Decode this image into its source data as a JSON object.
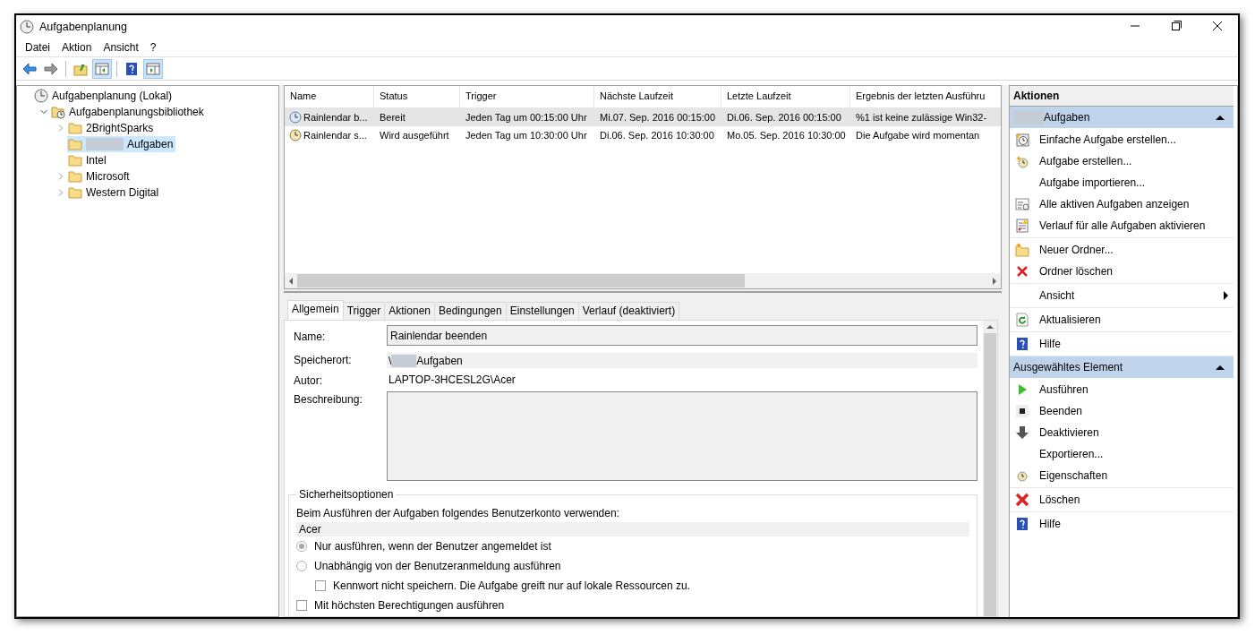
{
  "window": {
    "title": "Aufgabenplanung"
  },
  "menu": [
    "Datei",
    "Aktion",
    "Ansicht",
    "?"
  ],
  "toolbar": [
    [
      {
        "kind": "back",
        "on": false
      },
      {
        "kind": "forward",
        "on": false
      }
    ],
    [
      {
        "kind": "up",
        "on": false
      },
      {
        "kind": "tree-pane",
        "on": true
      }
    ],
    [
      {
        "kind": "help",
        "on": false
      },
      {
        "kind": "action-pane",
        "on": true
      }
    ]
  ],
  "tree": [
    {
      "label": "Aufgabenplanung (Lokal)",
      "kind": "scheduler",
      "selected": false,
      "redacted": false,
      "children": [
        {
          "label": "Aufgabenplanungsbibliothek",
          "kind": "library",
          "expanded": true,
          "selected": false,
          "redacted": false,
          "children": [
            {
              "label": "2BrightSparks",
              "kind": "folder",
              "expanded": false,
              "selected": false,
              "redacted": false
            },
            {
              "label": "Aufgaben",
              "kind": "folder",
              "selected": true,
              "redacted": true
            },
            {
              "label": "Intel",
              "kind": "folder",
              "selected": false,
              "redacted": false
            },
            {
              "label": "Microsoft",
              "kind": "folder",
              "expanded": false,
              "selected": false,
              "redacted": false
            },
            {
              "label": "Western Digital",
              "kind": "folder",
              "expanded": false,
              "selected": false,
              "redacted": false
            }
          ]
        }
      ]
    }
  ],
  "tasks": {
    "columns": [
      "Name",
      "Status",
      "Trigger",
      "Nächste Laufzeit",
      "Letzte Laufzeit",
      "Ergebnis der letzten Ausführu"
    ],
    "rows": [
      {
        "kind": "ready",
        "selected": true,
        "cells": [
          "Rainlendar b...",
          "Bereit",
          "Jeden Tag um 00:15:00 Uhr",
          "Mi.07. Sep. 2016 00:15:00",
          "Di.06. Sep. 2016 00:15:00",
          "%1 ist keine zulässige Win32-"
        ]
      },
      {
        "kind": "running",
        "selected": false,
        "cells": [
          "Rainlendar s...",
          "Wird ausgeführt",
          "Jeden Tag um 10:30:00 Uhr",
          "Di.06. Sep. 2016 10:30:00",
          "Mo.05. Sep. 2016 10:30:00",
          "Die Aufgabe wird momentan"
        ]
      }
    ]
  },
  "tabs": [
    {
      "label": "Allgemein",
      "selected": true
    },
    {
      "label": "Trigger",
      "selected": false
    },
    {
      "label": "Aktionen",
      "selected": false
    },
    {
      "label": "Bedingungen",
      "selected": false
    },
    {
      "label": "Einstellungen",
      "selected": false
    },
    {
      "label": "Verlauf (deaktiviert)",
      "selected": false
    }
  ],
  "general": {
    "name": {
      "label": "Name:",
      "value": "Rainlendar beenden"
    },
    "location": {
      "label": "Speicherort:",
      "prefix": "\\",
      "value": "Aufgaben",
      "redacted": true
    },
    "author": {
      "label": "Autor:",
      "value": "LAPTOP-3HCESL2G\\Acer"
    },
    "description": {
      "label": "Beschreibung:"
    }
  },
  "security": {
    "title": "Sicherheitsoptionen",
    "account_label": "Beim Ausführen der Aufgaben folgendes Benutzerkonto verwenden:",
    "account": "Acer",
    "options": [
      {
        "kind": "radio",
        "label": "Nur ausführen, wenn der Benutzer angemeldet ist",
        "selected": true
      },
      {
        "kind": "radio",
        "label": "Unabhängig von der Benutzeranmeldung ausführen",
        "selected": false,
        "children": [
          {
            "kind": "checkbox",
            "label": "Kennwort nicht speichern. Die Aufgabe greift nur auf lokale Ressourcen zu.",
            "selected": false
          }
        ]
      },
      {
        "kind": "checkbox",
        "label": "Mit höchsten Berechtigungen ausführen",
        "selected": false
      }
    ]
  },
  "actions": {
    "title": "Aktionen",
    "sections": [
      {
        "title": "Aufgaben",
        "redacted": true,
        "expanded": true,
        "groups": [
          [
            {
              "label": "Einfache Aufgabe erstellen...",
              "kind": "wizard",
              "submenu": false
            },
            {
              "label": "Aufgabe erstellen...",
              "kind": "create",
              "submenu": false
            },
            {
              "label": "Aufgabe importieren...",
              "kind": "plain",
              "submenu": false
            },
            {
              "label": "Alle aktiven Aufgaben anzeigen",
              "kind": "list",
              "submenu": false
            },
            {
              "label": "Verlauf für alle Aufgaben aktivieren",
              "kind": "log",
              "submenu": false
            }
          ],
          [
            {
              "label": "Neuer Ordner...",
              "kind": "new-folder",
              "submenu": false
            },
            {
              "label": "Ordner löschen",
              "kind": "delete",
              "submenu": false
            }
          ],
          [
            {
              "label": "Ansicht",
              "kind": "plain",
              "submenu": true
            }
          ],
          [
            {
              "label": "Aktualisieren",
              "kind": "refresh",
              "submenu": false
            }
          ],
          [
            {
              "label": "Hilfe",
              "kind": "help",
              "submenu": false
            }
          ]
        ]
      },
      {
        "title": "Ausgewähltes Element",
        "redacted": false,
        "expanded": true,
        "groups": [
          [
            {
              "label": "Ausführen",
              "kind": "run",
              "submenu": false
            },
            {
              "label": "Beenden",
              "kind": "stop",
              "submenu": false
            },
            {
              "label": "Deaktivieren",
              "kind": "disable",
              "submenu": false
            },
            {
              "label": "Exportieren...",
              "kind": "plain",
              "submenu": false
            },
            {
              "label": "Eigenschaften",
              "kind": "properties",
              "submenu": false
            }
          ],
          [
            {
              "label": "Löschen",
              "kind": "remove",
              "submenu": false
            }
          ],
          [
            {
              "label": "Hilfe",
              "kind": "help",
              "submenu": false
            }
          ]
        ]
      }
    ]
  }
}
